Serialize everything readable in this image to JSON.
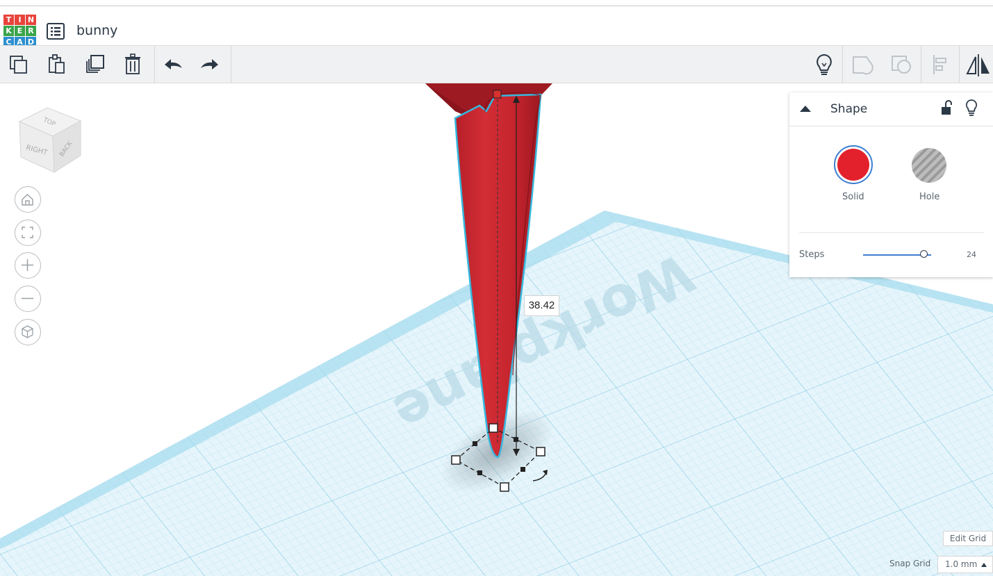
{
  "app": {
    "logo_letters": [
      "T",
      "I",
      "N",
      "K",
      "E",
      "R",
      "C",
      "A",
      "D"
    ],
    "logo_colors": [
      "#e8433b",
      "#e8433b",
      "#e8433b",
      "#3aa54a",
      "#3aa54a",
      "#3aa54a",
      "#2c8fd0",
      "#2c8fd0",
      "#2c8fd0"
    ],
    "project_title": "bunny",
    "list_icon": "list-icon"
  },
  "toolbar": {
    "left_buttons": [
      "copy-icon",
      "paste-icon",
      "duplicate-icon",
      "delete-icon",
      "undo-icon",
      "redo-icon"
    ],
    "right_buttons": [
      "lightbulb-icon",
      "group-icon",
      "ungroup-icon",
      "align-icon",
      "mirror-icon"
    ]
  },
  "view_cube": {
    "top": "TOP",
    "right": "RIGHT",
    "back": "BACK"
  },
  "nav_controls": [
    "home-view-icon",
    "fit-all-icon",
    "zoom-in-icon",
    "zoom-out-icon",
    "perspective-icon"
  ],
  "workplane": {
    "watermark": "Workplane",
    "grid_color": "#8fd3ea"
  },
  "shape": {
    "color": "#c5252e",
    "dimension_value": "38.42"
  },
  "inspector": {
    "title": "Shape",
    "solid_label": "Solid",
    "hole_label": "Hole",
    "solid_color": "#e3212d",
    "steps_label": "Steps",
    "steps_value": "24",
    "steps_fraction": 0.89
  },
  "grid_controls": {
    "edit_grid_label": "Edit Grid",
    "snap_grid_label": "Snap Grid",
    "snap_grid_value": "1.0 mm"
  }
}
